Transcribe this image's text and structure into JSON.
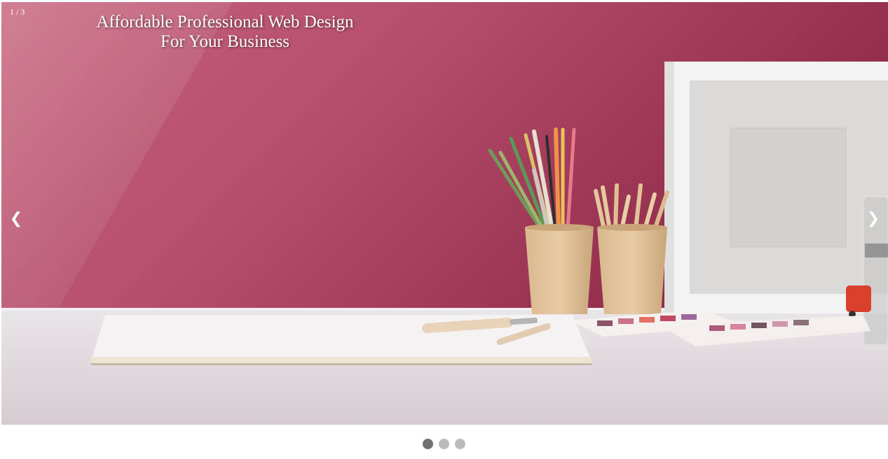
{
  "slideshow": {
    "counter": "1 / 3",
    "caption_line1": "Affordable Professional Web Design",
    "caption_line2": "For Your Business",
    "prev_label": "❮",
    "next_label": "❯",
    "slide_count": 3,
    "active_index": 0
  },
  "colors": {
    "wall": "#b24a6a",
    "desk": "#e6e3e6",
    "dot_active": "#717171",
    "dot_inactive": "#bbbbbb"
  }
}
